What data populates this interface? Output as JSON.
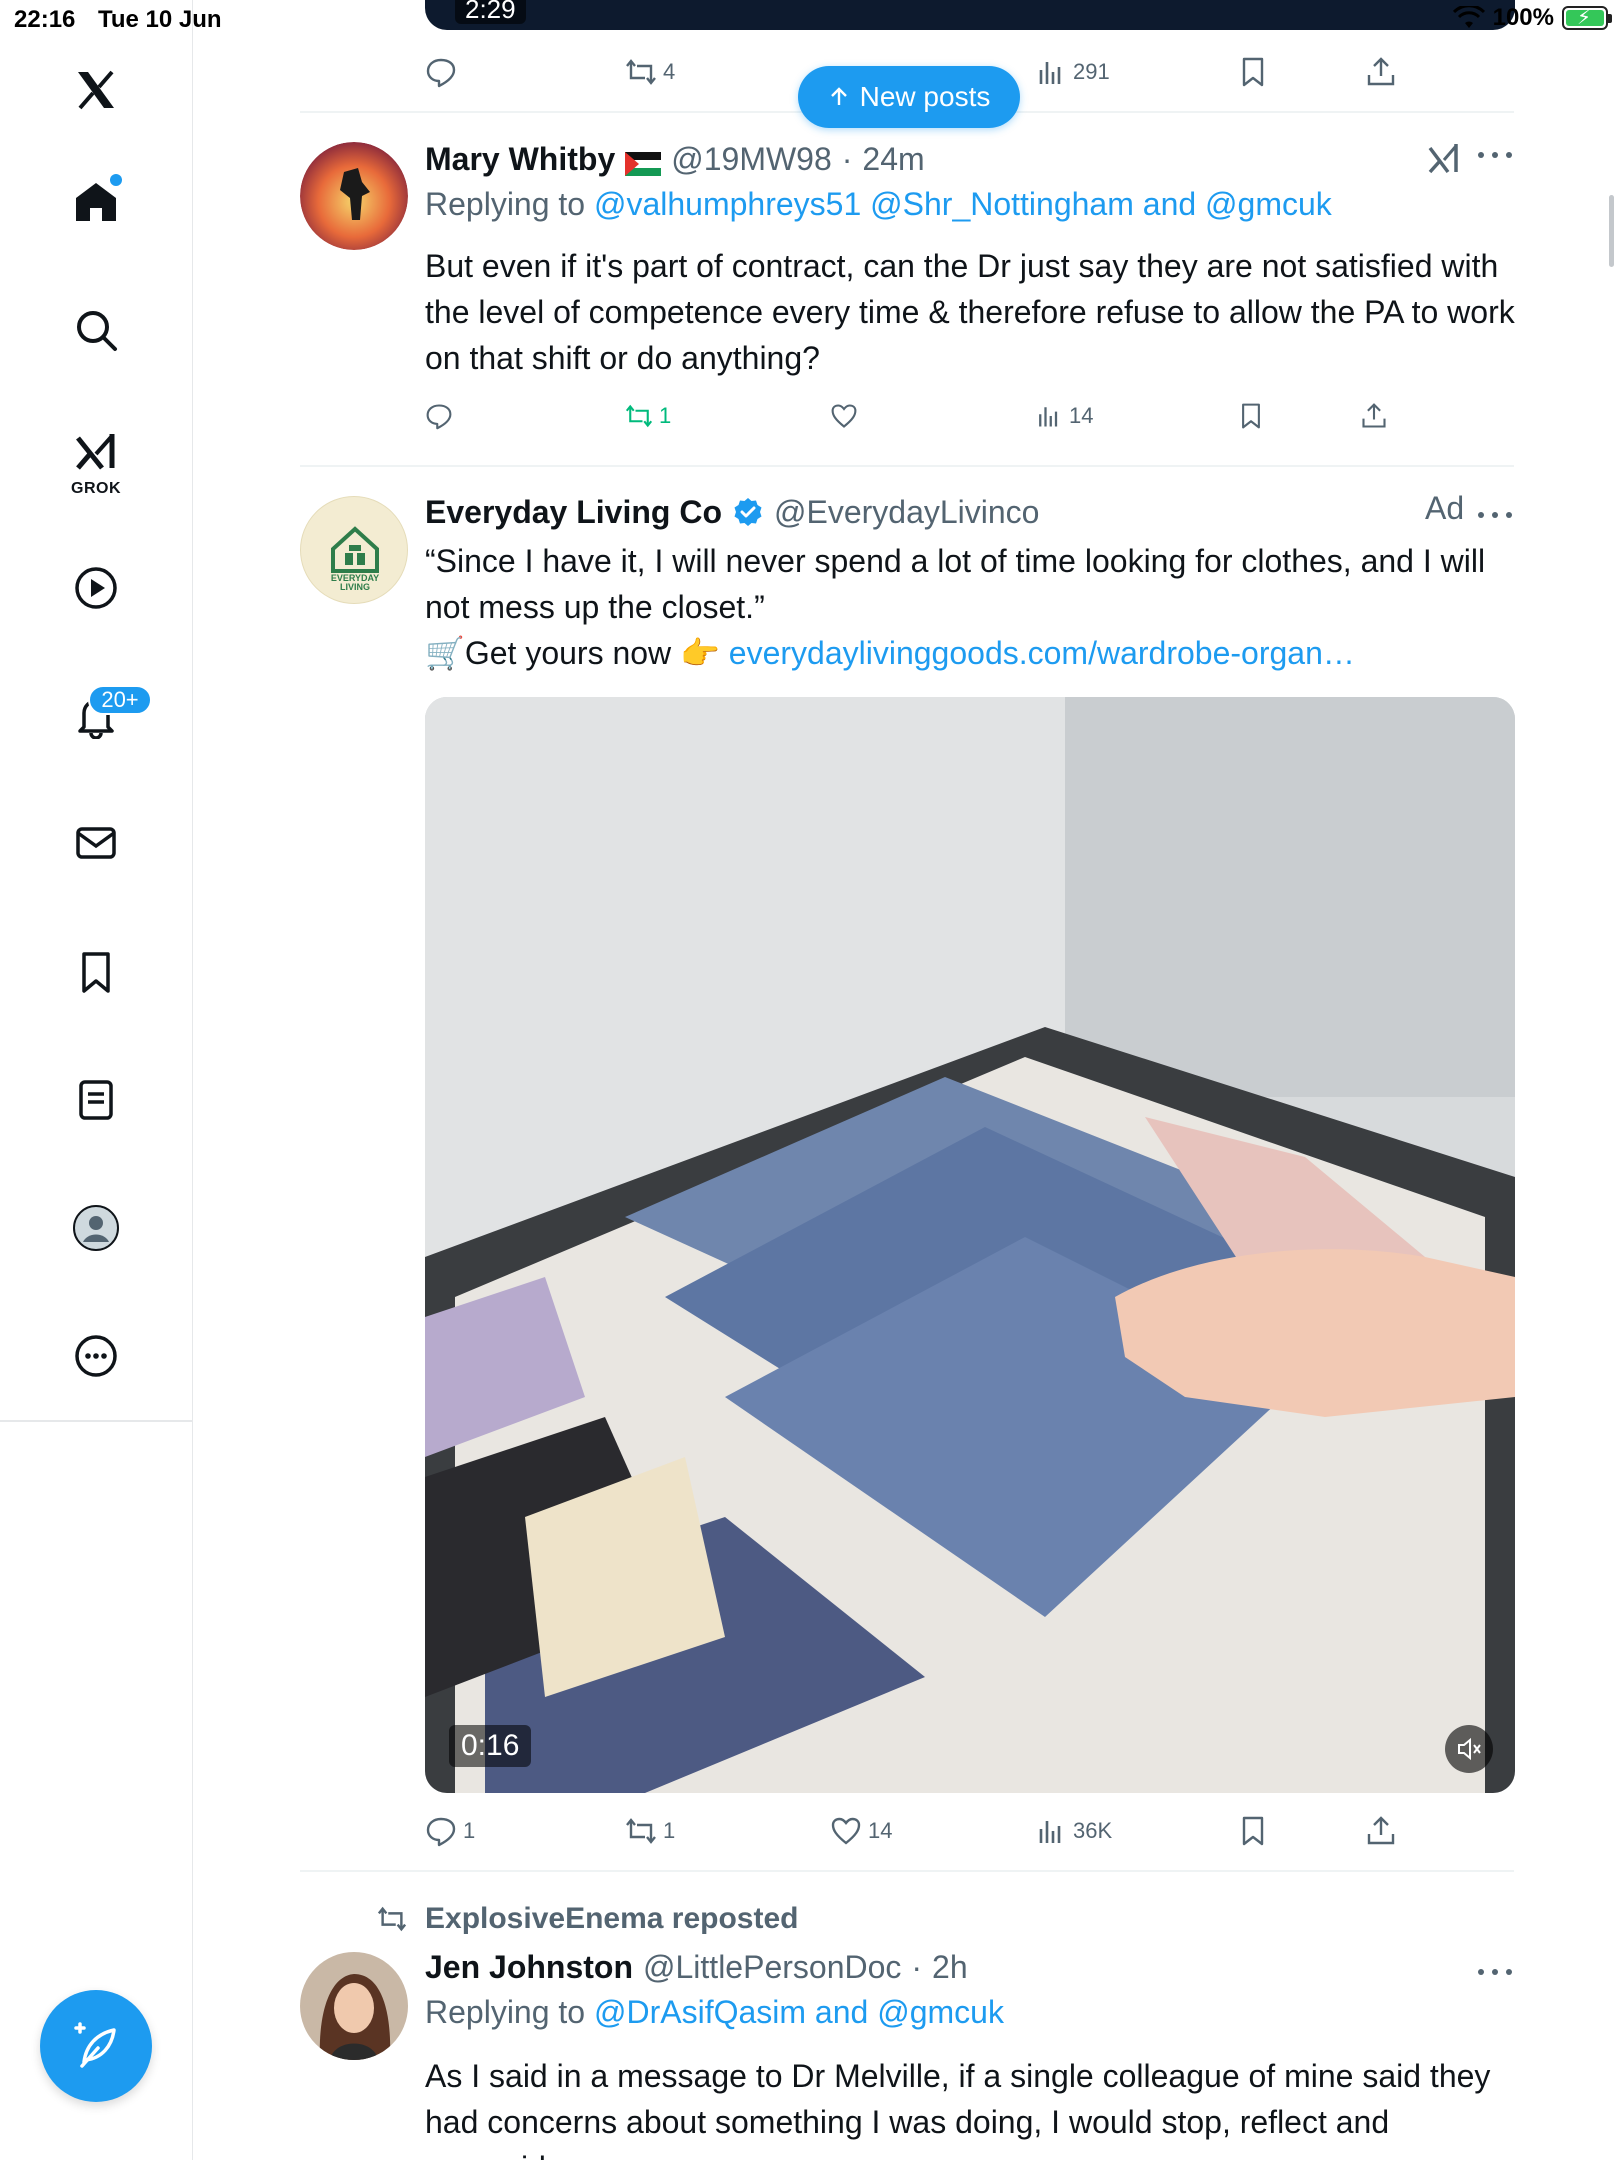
{
  "status_bar": {
    "time": "22:16",
    "date": "Tue 10 Jun",
    "battery": "100%"
  },
  "sidebar": {
    "grok_label": "GROK",
    "notifications_badge": "20+",
    "items": [
      "home",
      "explore",
      "grok",
      "videos",
      "notifications",
      "messages",
      "bookmarks",
      "lists",
      "profile",
      "more"
    ]
  },
  "new_posts_pill": {
    "label": "New posts"
  },
  "top_post": {
    "video_time": "2:29",
    "retweets": "4",
    "views": "291"
  },
  "post1": {
    "name": "Mary Whitby",
    "handle": "@19MW98",
    "sep": "·",
    "time": "24m",
    "replying_prefix": "Replying to",
    "reply_handles": "@valhumphreys51 @Shr_Nottingham and @gmcuk",
    "text": "But even if it's part of contract, can the Dr just say they are not satisfied with the level of competence every time & therefore refuse to allow the PA to work on that shift or do anything?",
    "retweets": "1",
    "views": "14"
  },
  "ad_post": {
    "name": "Everyday Living Co",
    "handle": "@EverydayLivinco",
    "ad_label": "Ad",
    "avatar_text_1": "EVERYDAY",
    "avatar_text_2": "LIVING",
    "text_line1": "“Since I have it, I will never spend a lot of time looking for clothes, and I will not mess up the closet.”",
    "cta_prefix": "🛒Get yours now 👉",
    "cta_link": "everydaylivinggoods.com/wardrobe-organ…",
    "video_time": "0:16",
    "replies": "1",
    "retweets": "1",
    "likes": "14",
    "views": "36K"
  },
  "post3": {
    "reposted_by": "ExplosiveEnema reposted",
    "name": "Jen Johnston",
    "handle": "@LittlePersonDoc",
    "sep": "·",
    "time": "2h",
    "replying_prefix": "Replying to",
    "reply_handles": "@DrAsifQasim and @gmcuk",
    "text": "As I said in a message to Dr Melville, if a single colleague of mine said they had concerns about something I was doing, I would stop, reflect and reconsider."
  },
  "colors": {
    "accent": "#1d9bf0",
    "text": "#0f1419",
    "muted": "#536471",
    "green": "#00ba7c"
  }
}
